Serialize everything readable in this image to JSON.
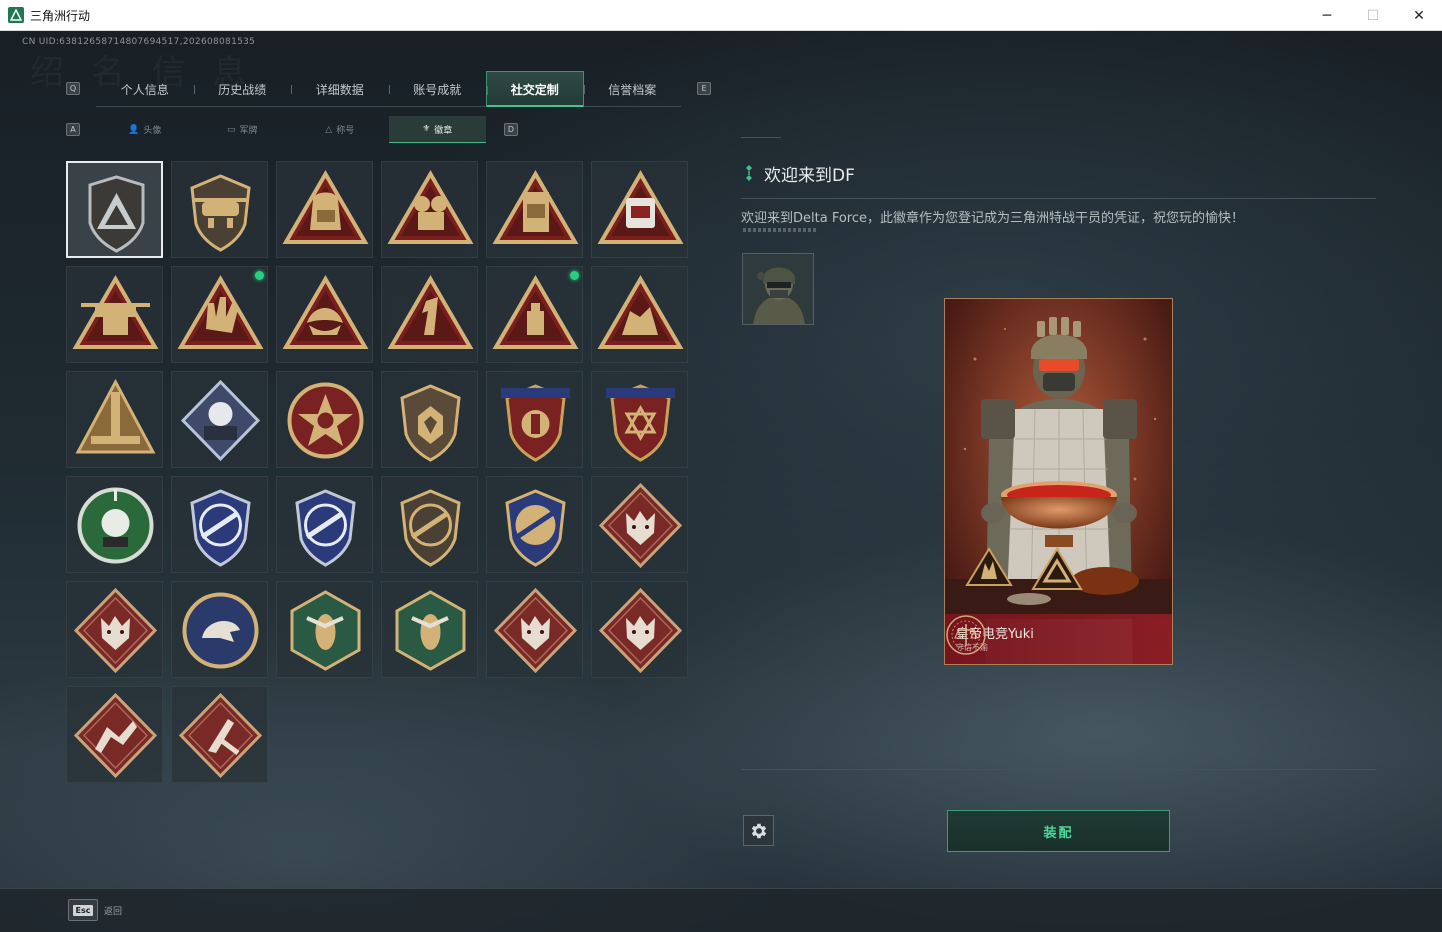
{
  "window": {
    "title": "三角洲行动",
    "minimize_glyph": "─",
    "maximize_glyph": "☐",
    "close_glyph": "✕"
  },
  "header": {
    "uid": "CN UID:638126587148076945​17,202608081535",
    "watermark": "绍 名 信 息"
  },
  "main_tabs": {
    "prev_key": "Q",
    "next_key": "E",
    "items": [
      {
        "label": "个人信息"
      },
      {
        "label": "历史战绩"
      },
      {
        "label": "详细数据"
      },
      {
        "label": "账号成就"
      },
      {
        "label": "社交定制",
        "active": true
      },
      {
        "label": "信誉档案"
      }
    ]
  },
  "sub_tabs": {
    "prev_key": "A",
    "next_key": "D",
    "items": [
      {
        "label": "头像",
        "icon": "person-icon",
        "glyph": "👤"
      },
      {
        "label": "军牌",
        "icon": "dogtag-icon",
        "glyph": "▭"
      },
      {
        "label": "称号",
        "icon": "title-icon",
        "glyph": "△"
      },
      {
        "label": "徽章",
        "icon": "badge-icon",
        "glyph": "⚜",
        "active": true
      }
    ]
  },
  "badges": {
    "selected_index": 0,
    "new_indices": [
      7,
      10
    ]
  },
  "detail": {
    "title": "欢迎来到DF",
    "description": "欢迎来到Delta Force，此徽章作为您登记成为三角洲特战干员的凭证，祝您玩的愉快！"
  },
  "card": {
    "name": "皇帝电竞Yuki",
    "subtitle": "守信不渝"
  },
  "actions": {
    "equip_label": "装配",
    "settings_icon": "gear-icon"
  },
  "footer": {
    "esc_key": "Esc",
    "back_label": "返回"
  },
  "colors": {
    "accent": "#46c08d",
    "equip_text": "#4ad99a",
    "new_dot": "#27d07c"
  }
}
